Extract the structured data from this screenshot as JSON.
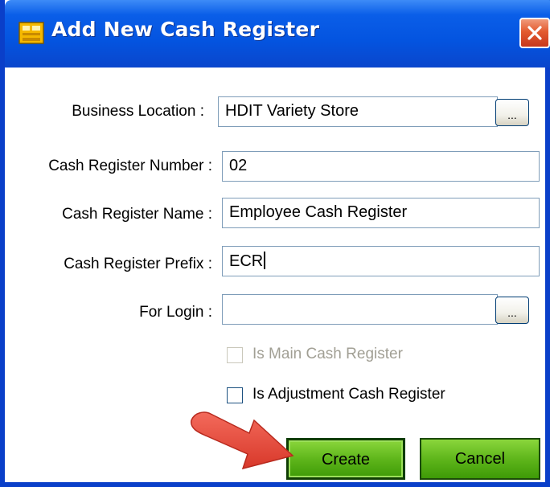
{
  "window": {
    "title": "Add New Cash Register",
    "icon": "cash-register-icon",
    "close_icon": "close-icon"
  },
  "form": {
    "business_location": {
      "label": "Business Location :",
      "value": "HDIT Variety Store",
      "browse_label": "..."
    },
    "cash_register_number": {
      "label": "Cash Register Number :",
      "value": "02"
    },
    "cash_register_name": {
      "label": "Cash Register Name :",
      "value": "Employee Cash Register"
    },
    "cash_register_prefix": {
      "label": "Cash Register Prefix :",
      "value": "ECR"
    },
    "for_login": {
      "label": "For Login :",
      "value": "",
      "browse_label": "..."
    },
    "is_main": {
      "label": "Is Main Cash Register",
      "checked": false,
      "disabled": true
    },
    "is_adjustment": {
      "label": "Is Adjustment Cash Register",
      "checked": false,
      "disabled": false
    }
  },
  "buttons": {
    "create": "Create",
    "cancel": "Cancel"
  },
  "colors": {
    "titlebar": "#0454e0",
    "button_green": "#5fb61b",
    "arrow": "#e84c3d"
  }
}
